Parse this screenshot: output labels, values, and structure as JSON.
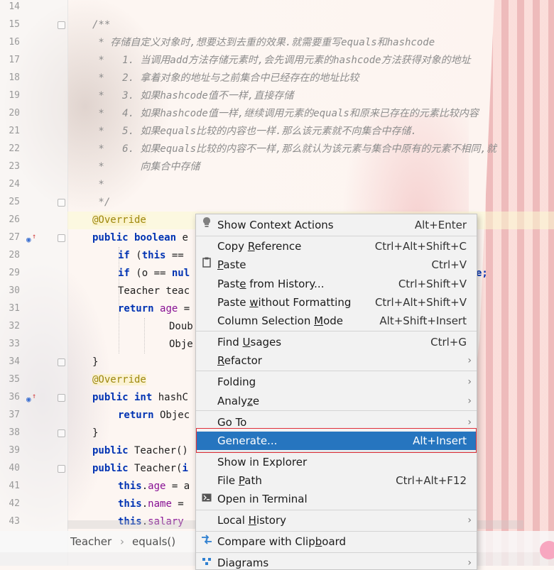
{
  "gutter": {
    "line_numbers": [
      "14",
      "15",
      "16",
      "17",
      "18",
      "19",
      "20",
      "21",
      "22",
      "23",
      "24",
      "25",
      "26",
      "27",
      "28",
      "29",
      "30",
      "31",
      "32",
      "33",
      "34",
      "35",
      "36",
      "37",
      "38",
      "39",
      "40",
      "41",
      "42",
      "43"
    ]
  },
  "code": {
    "l15": "/**",
    "l16": " * 存储自定义对象时,想要达到去重的效果.就需要重写equals和hashcode",
    "l17": " *   1. 当调用add方法存储元素时,会先调用元素的hashcode方法获得对象的地址",
    "l18": " *   2. 拿着对象的地址与之前集合中已经存在的地址比较",
    "l19": " *   3. 如果hashcode值不一样,直接存储",
    "l20": " *   4. 如果hashcode值一样,继续调用元素的equals和原来已存在的元素比较内容",
    "l21": " *   5. 如果equals比较的内容也一样.那么该元素就不向集合中存储.",
    "l22": " *   6. 如果equals比较的内容不一样,那么就认为该元素与集合中原有的元素不相同,就",
    "l23": " *      向集合中存储",
    "l24": " *",
    "l25": " */",
    "l26_ann": "@Override",
    "l27_kw": "public boolean",
    "l27_rest": " e",
    "l28_kw": "if",
    "l28_a": " (",
    "l28_kw2": "this",
    "l28_b": " ==",
    "l29_kw": "if",
    "l29_a": " (o == ",
    "l29_kw2": "nul",
    "l29_tail": "e;",
    "l30": "Teacher teac",
    "l31_kw": "return",
    "l31_fld": "age",
    "l31_b": " =",
    "l32": "Doub",
    "l33": "Obje",
    "l34": "}",
    "l35_ann": "@Override",
    "l36_kw": "public int",
    "l36_rest": " hashC",
    "l37_kw": "return",
    "l37_rest": " Objec",
    "l38": "}",
    "l39_kw": "public",
    "l39_rest": " Teacher()",
    "l40_kw": "public",
    "l40_rest": " Teacher(",
    "l40_kw2": "i",
    "l41_kw": "this",
    "l41_fld": "age",
    "l41_rest": " = a",
    "l42_kw": "this",
    "l42_fld": "name",
    "l42_rest": " =",
    "l43_kw": "this",
    "l43_fld": "salary"
  },
  "breadcrumb": {
    "class": "Teacher",
    "sep": "›",
    "method": "equals()"
  },
  "menu": {
    "items": [
      {
        "label": "Show Context Actions",
        "shortcut": "Alt+Enter",
        "icon": "lightbulb-icon"
      },
      {
        "label_pre": "Copy ",
        "label_u": "R",
        "label_post": "eference",
        "shortcut": "Ctrl+Alt+Shift+C"
      },
      {
        "label_pre": "",
        "label_u": "P",
        "label_post": "aste",
        "shortcut": "Ctrl+V",
        "icon": "clipboard-icon"
      },
      {
        "label_pre": "Past",
        "label_u": "e",
        "label_post": " from History...",
        "shortcut": "Ctrl+Shift+V"
      },
      {
        "label_pre": "Paste ",
        "label_u": "w",
        "label_post": "ithout Formatting",
        "shortcut": "Ctrl+Alt+Shift+V"
      },
      {
        "label_pre": "Column Selection ",
        "label_u": "M",
        "label_post": "ode",
        "shortcut": "Alt+Shift+Insert"
      },
      {
        "label_pre": "Find ",
        "label_u": "U",
        "label_post": "sages",
        "shortcut": "Ctrl+G"
      },
      {
        "label_pre": "",
        "label_u": "R",
        "label_post": "efactor",
        "shortcut": ""
      },
      {
        "label_pre": "Folding",
        "label_u": "",
        "label_post": "",
        "shortcut": ""
      },
      {
        "label_pre": "Analy",
        "label_u": "z",
        "label_post": "e",
        "shortcut": ""
      },
      {
        "label_pre": "Go To",
        "label_u": "",
        "label_post": "",
        "shortcut": ""
      },
      {
        "label_pre": "Generate...",
        "label_u": "",
        "label_post": "",
        "shortcut": "Alt+Insert"
      },
      {
        "label_pre": "Show in Explorer",
        "label_u": "",
        "label_post": "",
        "shortcut": ""
      },
      {
        "label_pre": "File ",
        "label_u": "P",
        "label_post": "ath",
        "shortcut": "Ctrl+Alt+F12"
      },
      {
        "label_pre": "Open in Terminal",
        "label_u": "",
        "label_post": "",
        "shortcut": "",
        "icon": "terminal-icon"
      },
      {
        "label_pre": "Local ",
        "label_u": "H",
        "label_post": "istory",
        "shortcut": ""
      },
      {
        "label_pre": "Compare with Clip",
        "label_u": "b",
        "label_post": "oard",
        "shortcut": "",
        "icon": "compare-icon"
      },
      {
        "label_pre": "Diagrams",
        "label_u": "",
        "label_post": "",
        "shortcut": "",
        "icon": "diagram-icon"
      }
    ],
    "submenu_arrow": "›",
    "selected_color": "#2675bf"
  }
}
